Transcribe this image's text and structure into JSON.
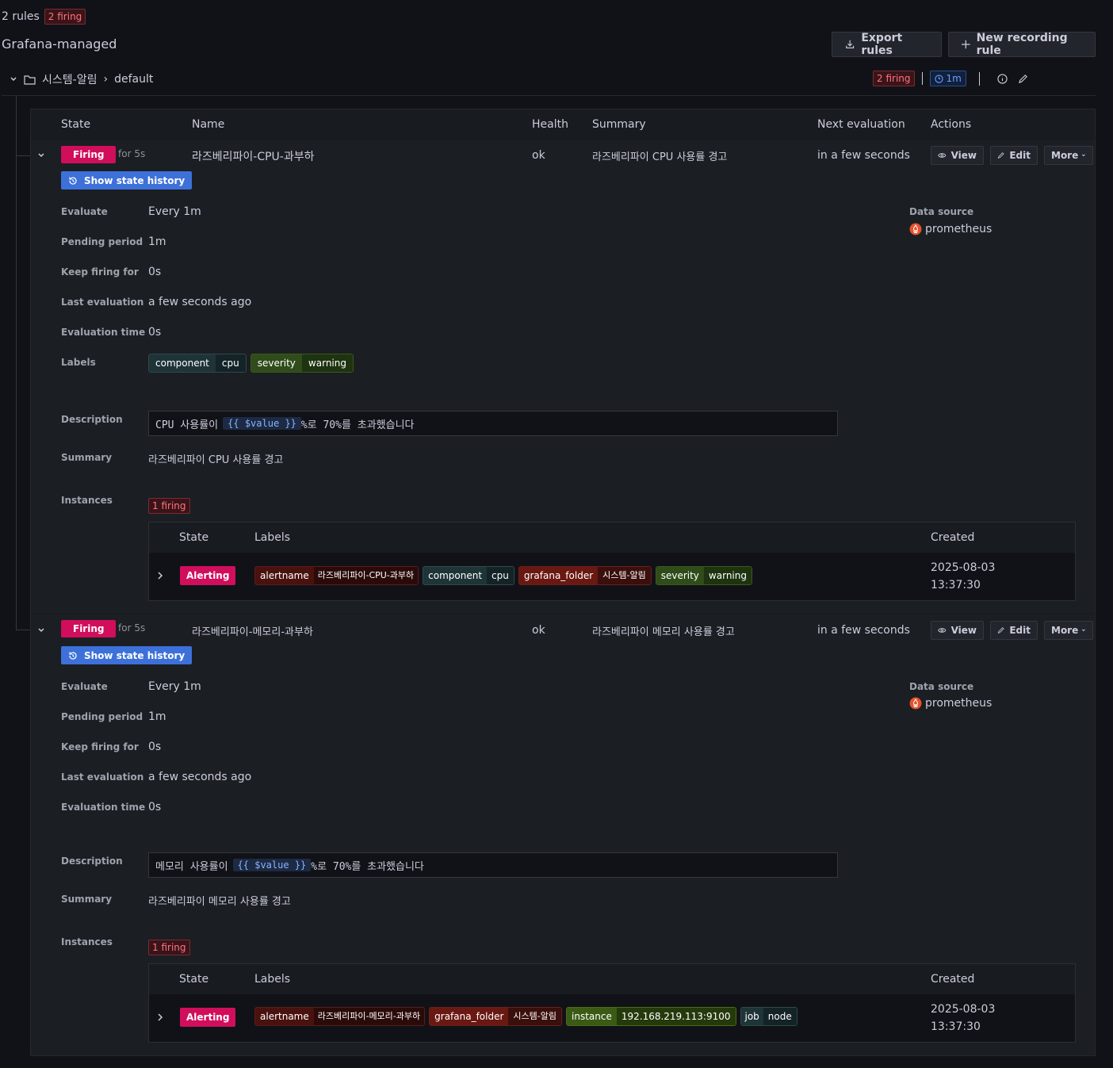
{
  "header": {
    "rules_count": "2 rules",
    "firing_badge": "2 firing",
    "title": "Grafana-managed"
  },
  "toolbar": {
    "export": "Export rules",
    "new_recording": "New recording rule"
  },
  "group": {
    "folder": "시스템-알림",
    "separator": "›",
    "name": "default",
    "firing": "2 firing",
    "interval": "1m"
  },
  "table_headers": {
    "state": "State",
    "name": "Name",
    "health": "Health",
    "summary": "Summary",
    "next_eval": "Next evaluation",
    "actions": "Actions"
  },
  "actions": {
    "view": "View",
    "edit": "Edit",
    "more": "More"
  },
  "detail_labels": {
    "evaluate": "Evaluate",
    "pending": "Pending period",
    "keep_firing": "Keep firing for",
    "last_eval": "Last evaluation",
    "eval_time": "Evaluation time",
    "labels": "Labels",
    "description": "Description",
    "summary": "Summary",
    "instances": "Instances",
    "datasource": "Data source"
  },
  "instance_headers": {
    "state": "State",
    "labels": "Labels",
    "created": "Created"
  },
  "rules": [
    {
      "state": "Firing",
      "for": "for 5s",
      "name": "라즈베리파이-CPU-과부하",
      "health": "ok",
      "summary": "라즈베리파이 CPU 사용률 경고",
      "next_eval": "in a few seconds",
      "history_button": "Show state history",
      "evaluate": "Every 1m",
      "pending": "1m",
      "keep_firing": "0s",
      "last_eval": "a few seconds ago",
      "eval_time": "0s",
      "datasource": "prometheus",
      "labels": [
        {
          "k": "component",
          "v": "cpu"
        },
        {
          "k": "severity",
          "v": "warning"
        }
      ],
      "description_pre": "CPU 사용률이",
      "description_code": "{{ $value }}",
      "description_post": "%로 70%를 초과했습니다",
      "summary_detail": "라즈베리파이 CPU 사용률 경고",
      "instances_firing": "1 firing",
      "instance": {
        "state": "Alerting",
        "labels": [
          {
            "k": "alertname",
            "v": "라즈베리파이-CPU-과부하"
          },
          {
            "k": "component",
            "v": "cpu"
          },
          {
            "k": "grafana_folder",
            "v": "시스템-알림"
          },
          {
            "k": "severity",
            "v": "warning"
          }
        ],
        "created_date": "2025-08-03",
        "created_time": "13:37:30"
      }
    },
    {
      "state": "Firing",
      "for": "for 5s",
      "name": "라즈베리파이-메모리-과부하",
      "health": "ok",
      "summary": "라즈베리파이 메모리 사용률 경고",
      "next_eval": "in a few seconds",
      "history_button": "Show state history",
      "evaluate": "Every 1m",
      "pending": "1m",
      "keep_firing": "0s",
      "last_eval": "a few seconds ago",
      "eval_time": "0s",
      "datasource": "prometheus",
      "description_pre": "메모리 사용률이",
      "description_code": "{{ $value }}",
      "description_post": "%로 70%를 초과했습니다",
      "summary_detail": "라즈베리파이 메모리 사용률 경고",
      "instances_firing": "1 firing",
      "instance": {
        "state": "Alerting",
        "labels": [
          {
            "k": "alertname",
            "v": "라즈베리파이-메모리-과부하"
          },
          {
            "k": "grafana_folder",
            "v": "시스템-알림"
          },
          {
            "k": "instance",
            "v": "192.168.219.113:9100"
          },
          {
            "k": "job",
            "v": "node"
          }
        ],
        "created_date": "2025-08-03",
        "created_time": "13:37:30"
      }
    }
  ],
  "colors": {
    "firing": "#d10e5c",
    "history": "#3d71d9",
    "background": "#111217"
  },
  "icons": [
    "export-icon",
    "plus-icon",
    "chevron-down-icon",
    "folder-icon",
    "clock-icon",
    "info-icon",
    "pencil-icon",
    "eye-icon",
    "history-icon",
    "prometheus-icon",
    "chevron-right-icon"
  ]
}
